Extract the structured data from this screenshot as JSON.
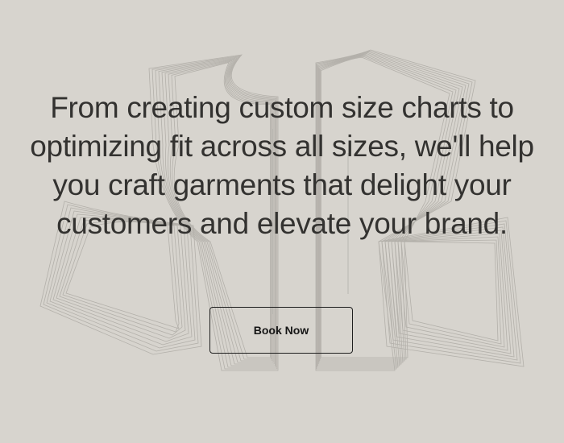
{
  "hero": {
    "headline": "From creating custom size charts to optimizing fit across all sizes, we'll help you craft garments that delight your customers and elevate your brand.",
    "cta_label": "Book Now"
  },
  "colors": {
    "background": "#d7d4ce",
    "text": "#333230",
    "button_border": "#1f1f1f"
  }
}
